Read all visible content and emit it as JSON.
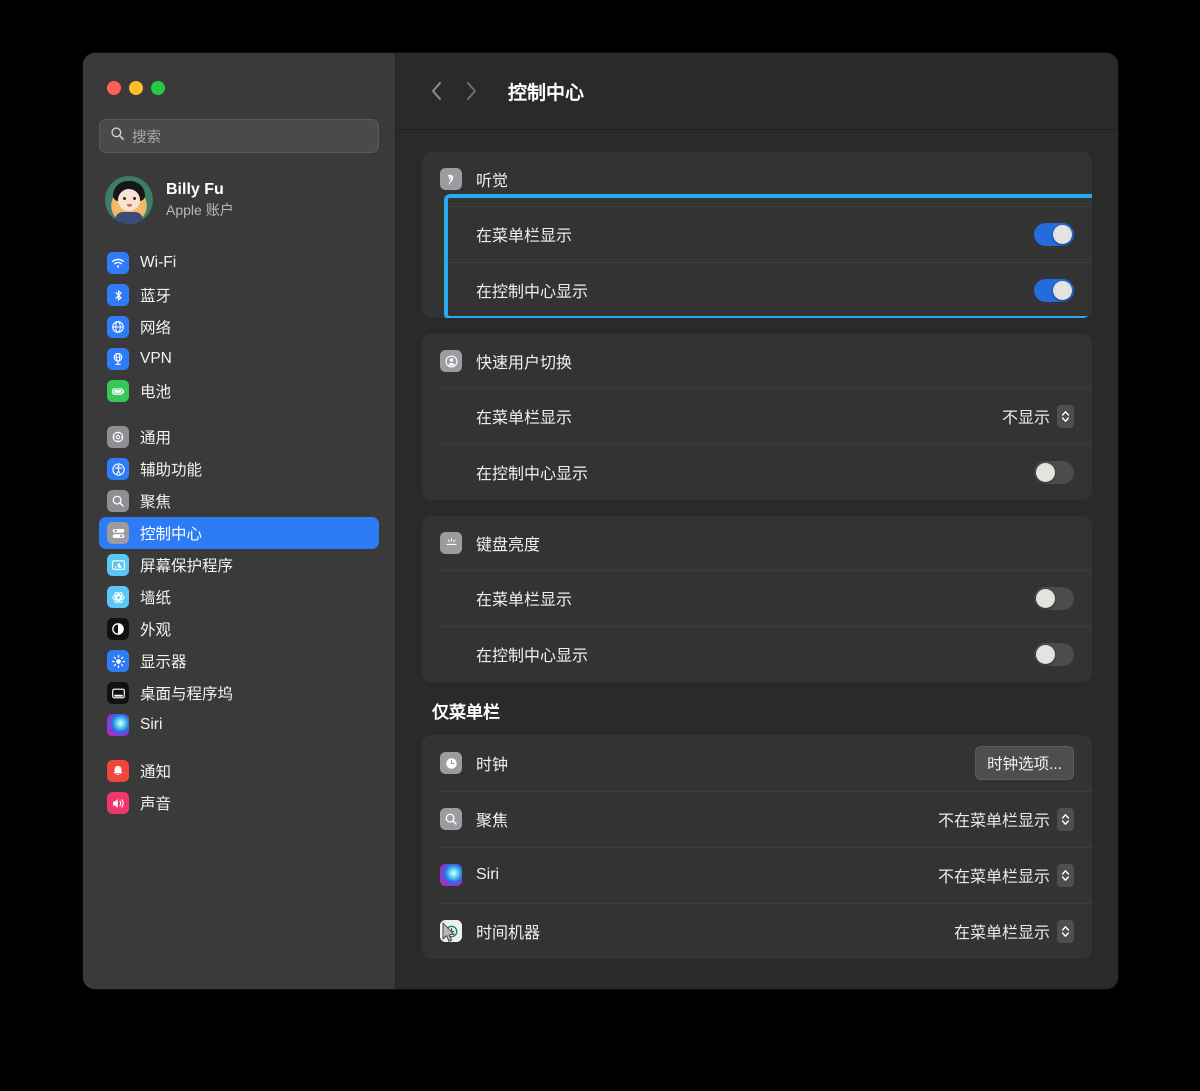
{
  "window": {
    "traffic_lights": [
      "close",
      "minimize",
      "zoom"
    ],
    "colors": {
      "accent_blue": "#2d7cf6",
      "toggle_on": "#246bdb",
      "highlight_outline": "#2aa9f0",
      "sidebar_bg": "#3a3a3a",
      "detail_bg": "#2a2a2a",
      "card_bg": "#333333"
    }
  },
  "sidebar": {
    "search": {
      "placeholder": "搜索",
      "value": ""
    },
    "account": {
      "name": "Billy Fu",
      "subtitle": "Apple 账户"
    },
    "groups": [
      {
        "items": [
          {
            "label": "Wi-Fi",
            "icon": "wifi-icon"
          },
          {
            "label": "蓝牙",
            "icon": "bluetooth-icon"
          },
          {
            "label": "网络",
            "icon": "network-icon"
          },
          {
            "label": "VPN",
            "icon": "vpn-icon"
          },
          {
            "label": "电池",
            "icon": "battery-icon"
          }
        ]
      },
      {
        "items": [
          {
            "label": "通用",
            "icon": "gear-icon"
          },
          {
            "label": "辅助功能",
            "icon": "accessibility-icon"
          },
          {
            "label": "聚焦",
            "icon": "spotlight-search-icon"
          },
          {
            "label": "控制中心",
            "icon": "control-center-icon",
            "selected": true
          },
          {
            "label": "屏幕保护程序",
            "icon": "screensaver-icon"
          },
          {
            "label": "墙纸",
            "icon": "wallpaper-icon"
          },
          {
            "label": "外观",
            "icon": "appearance-icon"
          },
          {
            "label": "显示器",
            "icon": "display-icon"
          },
          {
            "label": "桌面与程序坞",
            "icon": "desktop-dock-icon"
          },
          {
            "label": "Siri",
            "icon": "siri-icon"
          }
        ]
      },
      {
        "items": [
          {
            "label": "通知",
            "icon": "notifications-icon"
          },
          {
            "label": "声音",
            "icon": "sound-icon"
          }
        ]
      }
    ]
  },
  "toolbar": {
    "back_label": "后退",
    "forward_label": "前进",
    "title": "控制中心"
  },
  "main": {
    "cards": [
      {
        "id": "hearing",
        "header": {
          "label": "听觉",
          "icon": "hearing-ear-icon"
        },
        "highlighted": true,
        "rows": [
          {
            "label": "在菜单栏显示",
            "control": "toggle",
            "state": "on"
          },
          {
            "label": "在控制中心显示",
            "control": "toggle",
            "state": "on"
          }
        ]
      },
      {
        "id": "fast-user-switching",
        "header": {
          "label": "快速用户切换",
          "icon": "user-account-icon"
        },
        "highlighted": false,
        "rows": [
          {
            "label": "在菜单栏显示",
            "control": "popup",
            "value": "不显示"
          },
          {
            "label": "在控制中心显示",
            "control": "toggle",
            "state": "off"
          }
        ]
      },
      {
        "id": "keyboard-brightness",
        "header": {
          "label": "键盘亮度",
          "icon": "keyboard-brightness-icon"
        },
        "highlighted": false,
        "rows": [
          {
            "label": "在菜单栏显示",
            "control": "toggle",
            "state": "off"
          },
          {
            "label": "在控制中心显示",
            "control": "toggle",
            "state": "off"
          }
        ]
      }
    ],
    "menu_bar_only": {
      "title": "仅菜单栏",
      "rows": [
        {
          "label": "时钟",
          "icon": "clock-icon",
          "control": "button",
          "value": "时钟选项..."
        },
        {
          "label": "聚焦",
          "icon": "spotlight-search-icon",
          "control": "popup",
          "value": "不在菜单栏显示"
        },
        {
          "label": "Siri",
          "icon": "siri-icon",
          "control": "popup",
          "value": "不在菜单栏显示"
        },
        {
          "label": "时间机器",
          "icon": "time-machine-icon",
          "control": "popup",
          "value": "在菜单栏显示"
        }
      ]
    }
  }
}
